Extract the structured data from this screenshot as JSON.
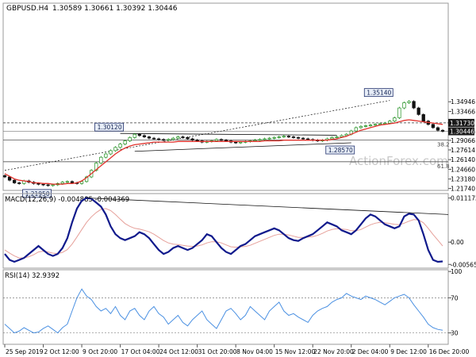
{
  "chart_data": [
    {
      "type": "candlestick",
      "panel": "price",
      "header": {
        "symbol": "GBPUSD.H4",
        "ohlc": "1.30589 1.30661 1.30392 1.30446"
      },
      "ylim": [
        1.2145,
        1.4995
      ],
      "yticks": [
        "1.34946",
        "1.33466",
        "1.30446",
        "1.29066",
        "1.27614",
        "1.26140",
        "1.24660",
        "1.23180",
        "1.21740"
      ],
      "ytick_values": [
        1.34946,
        1.33466,
        1.30446,
        1.29066,
        1.27614,
        1.2614,
        1.2466,
        1.2318,
        1.2174
      ],
      "current_price": "1.30446",
      "current_price_value": 1.30446,
      "level_label": "1.31730",
      "level_value": 1.3173,
      "fib_levels": [
        {
          "label": "38.2",
          "value": 1.2914
        },
        {
          "label": "61.8",
          "value": 1.2581
        }
      ],
      "annotations": [
        {
          "text": "1.35140",
          "value": 1.3514
        },
        {
          "text": "1.30120",
          "value": 1.3012
        },
        {
          "text": "1.28570",
          "value": 1.2857
        },
        {
          "text": "1.21950",
          "value": 1.2195
        }
      ],
      "close_series": [
        1.235,
        1.23,
        1.226,
        1.225,
        1.229,
        1.227,
        1.225,
        1.224,
        1.223,
        1.222,
        1.223,
        1.225,
        1.227,
        1.228,
        1.226,
        1.225,
        1.228,
        1.235,
        1.245,
        1.256,
        1.265,
        1.27,
        1.275,
        1.28,
        1.285,
        1.29,
        1.295,
        1.3,
        1.298,
        1.296,
        1.294,
        1.293,
        1.292,
        1.291,
        1.292,
        1.294,
        1.296,
        1.295,
        1.293,
        1.291,
        1.29,
        1.288,
        1.289,
        1.29,
        1.292,
        1.291,
        1.29,
        1.288,
        1.287,
        1.288,
        1.289,
        1.29,
        1.291,
        1.292,
        1.293,
        1.294,
        1.295,
        1.296,
        1.297,
        1.296,
        1.295,
        1.294,
        1.293,
        1.292,
        1.291,
        1.29,
        1.291,
        1.293,
        1.295,
        1.296,
        1.298,
        1.3,
        1.305,
        1.31,
        1.312,
        1.313,
        1.314,
        1.315,
        1.316,
        1.317,
        1.32,
        1.325,
        1.34,
        1.348,
        1.35,
        1.34,
        1.33,
        1.32,
        1.315,
        1.31,
        1.306,
        1.3045
      ],
      "ma_series": [
        1.24,
        1.236,
        1.232,
        1.23,
        1.229,
        1.228,
        1.226,
        1.226,
        1.225,
        1.225,
        1.224,
        1.224,
        1.224,
        1.225,
        1.225,
        1.226,
        1.229,
        1.234,
        1.24,
        1.246,
        1.252,
        1.258,
        1.264,
        1.27,
        1.275,
        1.279,
        1.282,
        1.284,
        1.285,
        1.286,
        1.287,
        1.288,
        1.288,
        1.288,
        1.288,
        1.288,
        1.289,
        1.289,
        1.289,
        1.289,
        1.289,
        1.289,
        1.289,
        1.289,
        1.289,
        1.289,
        1.289,
        1.289,
        1.289,
        1.289,
        1.289,
        1.289,
        1.289,
        1.289,
        1.29,
        1.29,
        1.29,
        1.29,
        1.291,
        1.291,
        1.291,
        1.291,
        1.291,
        1.291,
        1.291,
        1.291,
        1.291,
        1.291,
        1.292,
        1.293,
        1.295,
        1.297,
        1.3,
        1.303,
        1.306,
        1.308,
        1.31,
        1.312,
        1.314,
        1.315,
        1.316,
        1.317,
        1.319,
        1.321,
        1.322,
        1.321,
        1.32,
        1.319,
        1.318,
        1.317,
        1.316,
        1.315
      ]
    },
    {
      "type": "line",
      "panel": "macd",
      "header": "MACD(12,26,9) -0.004885 -0.004369",
      "ylim": [
        -0.0066,
        0.0123
      ],
      "yticks": [
        "0.011172",
        "0.00",
        "-0.00565"
      ],
      "ytick_values": [
        0.011172,
        0.0,
        -0.00565
      ],
      "series": [
        {
          "values": [
            -0.003,
            -0.0045,
            -0.005,
            -0.0045,
            -0.004,
            -0.003,
            -0.002,
            -0.001,
            -0.002,
            -0.003,
            -0.0035,
            -0.003,
            -0.0015,
            0.001,
            0.005,
            0.0085,
            0.0105,
            0.0112,
            0.011,
            0.01,
            0.009,
            0.007,
            0.004,
            0.002,
            0.001,
            0.0005,
            0.001,
            0.0015,
            0.0025,
            0.002,
            0.001,
            -0.0005,
            -0.002,
            -0.003,
            -0.0025,
            -0.0015,
            -0.001,
            -0.0015,
            -0.002,
            -0.0015,
            -0.0005,
            0.0005,
            0.002,
            0.0015,
            0.0,
            -0.0015,
            -0.0025,
            -0.003,
            -0.002,
            -0.001,
            -0.0005,
            0.0005,
            0.0015,
            0.002,
            0.0025,
            0.003,
            0.0035,
            0.003,
            0.002,
            0.001,
            0.0005,
            0.0003,
            0.001,
            0.0015,
            0.002,
            0.003,
            0.004,
            0.005,
            0.0045,
            0.004,
            0.003,
            0.0025,
            0.002,
            0.003,
            0.0045,
            0.006,
            0.007,
            0.0065,
            0.0055,
            0.0045,
            0.004,
            0.0035,
            0.004,
            0.0065,
            0.0072,
            0.007,
            0.0055,
            0.002,
            -0.002,
            -0.0045,
            -0.005,
            -0.0049
          ]
        },
        {
          "values": [
            -0.002,
            -0.0028,
            -0.0035,
            -0.004,
            -0.004,
            -0.0037,
            -0.0032,
            -0.0025,
            -0.0023,
            -0.0025,
            -0.0028,
            -0.0029,
            -0.0026,
            -0.0019,
            -0.0005,
            0.0013,
            0.0032,
            0.005,
            0.0064,
            0.0075,
            0.0083,
            0.0085,
            0.008,
            0.007,
            0.0058,
            0.0047,
            0.004,
            0.0035,
            0.0033,
            0.003,
            0.0026,
            0.002,
            0.0012,
            0.0004,
            -0.0002,
            -0.0005,
            -0.0006,
            -0.0008,
            -0.001,
            -0.0011,
            -0.001,
            -0.0007,
            -0.0002,
            0.0001,
            0.0001,
            -0.0002,
            -0.0007,
            -0.0012,
            -0.0013,
            -0.0012,
            -0.0011,
            -0.0008,
            -0.0003,
            0.0002,
            0.0007,
            0.0012,
            0.0017,
            0.002,
            0.002,
            0.0018,
            0.0015,
            0.0012,
            0.0012,
            0.0013,
            0.0014,
            0.0017,
            0.0022,
            0.0028,
            0.0032,
            0.0034,
            0.0033,
            0.0032,
            0.0029,
            0.0029,
            0.0032,
            0.0038,
            0.0044,
            0.0048,
            0.005,
            0.0049,
            0.0047,
            0.0045,
            0.0044,
            0.0048,
            0.0053,
            0.0057,
            0.0056,
            0.0049,
            0.0035,
            0.0019,
            0.0005,
            -0.001
          ]
        }
      ],
      "divergence_line": {
        "x": [
          17,
          91
        ],
        "y": [
          0.0112,
          0.007
        ]
      }
    },
    {
      "type": "line",
      "panel": "rsi",
      "header": "RSI(14) 32.9392",
      "ylim": [
        17,
        102
      ],
      "yticks": [
        "100",
        "70",
        "30"
      ],
      "ytick_values": [
        100,
        70,
        30
      ],
      "series": [
        {
          "values": [
            40,
            35,
            30,
            32,
            36,
            33,
            30,
            31,
            35,
            38,
            34,
            30,
            36,
            40,
            55,
            70,
            80,
            72,
            68,
            60,
            55,
            58,
            52,
            60,
            50,
            45,
            55,
            58,
            50,
            45,
            55,
            60,
            52,
            48,
            40,
            45,
            50,
            42,
            38,
            45,
            50,
            55,
            45,
            40,
            35,
            45,
            55,
            58,
            52,
            45,
            50,
            60,
            55,
            50,
            45,
            55,
            60,
            65,
            55,
            50,
            52,
            48,
            45,
            42,
            50,
            55,
            58,
            60,
            65,
            68,
            70,
            75,
            72,
            70,
            68,
            72,
            70,
            68,
            65,
            62,
            66,
            70,
            72,
            74,
            70,
            62,
            55,
            48,
            40,
            36,
            34,
            33
          ]
        }
      ]
    }
  ],
  "x_axis": {
    "labels": [
      "25 Sep 2019",
      "2 Oct 12:00",
      "9 Oct 20:00",
      "17 Oct 04:00",
      "24 Oct 12:00",
      "31 Oct 20:00",
      "8 Nov 04:00",
      "15 Nov 12:00",
      "22 Nov 20:00",
      "2 Dec 04:00",
      "9 Dec 12:00",
      "16 Dec 20:00"
    ],
    "label_index": [
      0,
      8,
      16,
      24,
      32,
      40,
      48,
      56,
      64,
      72,
      80,
      88
    ]
  },
  "watermark": "ActionForex.com",
  "colors": {
    "up": "#1f8f1f",
    "down": "#111111",
    "ma": "#e0312b",
    "macd": "#101a8c",
    "signal": "#e6a09a",
    "rsi": "#4a90e2",
    "current_bg": "#1a1a1a",
    "level_bg": "#1a1a1a",
    "annotation_bg": "#e8eef8",
    "annotation_border": "#1f2f6b",
    "trend": "#111111"
  }
}
